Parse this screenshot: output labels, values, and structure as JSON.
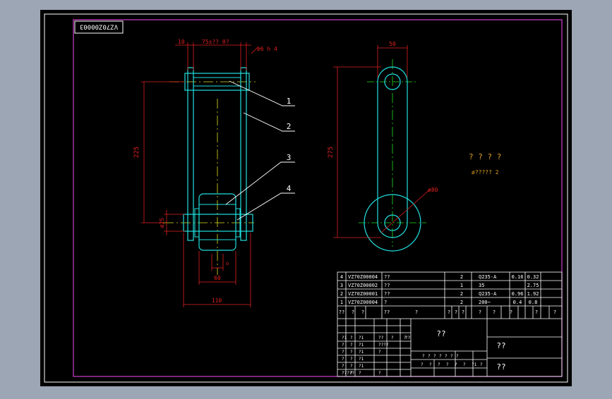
{
  "drawing": {
    "code_box": "VZ70Z00003",
    "title_block_main": "??",
    "title_block_name": "??",
    "title_block_company": "??",
    "notes": [
      "? ? ? ?",
      "ø?????  2"
    ]
  },
  "dimensions": {
    "top_left": "10",
    "top_main": "75±?? 0?",
    "top_right": "ø6 h 4",
    "height_left": "225",
    "dia_left": "ø25",
    "bottom_inner": "60",
    "bottom_outer": "110",
    "small_o": "o",
    "side_width": "50",
    "side_height": "275",
    "side_dia": "ø80"
  },
  "callouts": [
    "1",
    "2",
    "3",
    "4"
  ],
  "bom": [
    {
      "no": "4",
      "code": "VZ70Z00004",
      "name": "??",
      "qty": "2",
      "material": "Q235-A",
      "w1": "0.16",
      "w2": "0.32"
    },
    {
      "no": "3",
      "code": "VZ70Z00002",
      "name": "??",
      "qty": "1",
      "material": "35",
      "w1": "",
      "w2": "2.75"
    },
    {
      "no": "2",
      "code": "VZ70Z00001",
      "name": "??",
      "qty": "2",
      "material": "Q235-A",
      "w1": "0.96",
      "w2": "1.92"
    },
    {
      "no": "1",
      "code": "VZ70Z00004",
      "name": "?",
      "qty": "2",
      "material": "200~",
      "w1": "0.4",
      "w2": "0.8"
    }
  ],
  "bom_header": [
    "??",
    "?",
    "?",
    "??",
    "?",
    "?",
    "?",
    "?",
    "?",
    "?",
    "?",
    "?",
    "?"
  ],
  "title_cells": {
    "r1": [
      "?1",
      "?",
      "?1",
      "??",
      "?",
      "?",
      "??"
    ],
    "r2": [
      "?",
      "?",
      "?1",
      "????"
    ],
    "r3": [
      "?",
      "?",
      "?1",
      "?"
    ],
    "r4": [
      "?",
      "?",
      "?1"
    ],
    "r5": [
      "?",
      "?",
      "?1"
    ],
    "r6": [
      "?????",
      "?",
      "?",
      "?"
    ],
    "mid1": [
      "?",
      "?",
      "?",
      "?",
      "?",
      "?",
      "?"
    ],
    "mid2": [
      "?",
      "?",
      "?",
      "?",
      "?",
      "?",
      "?1",
      "?"
    ]
  }
}
